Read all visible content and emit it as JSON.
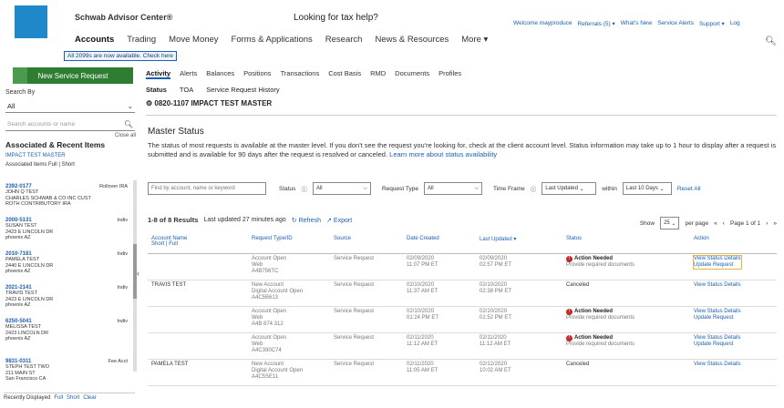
{
  "header": {
    "brand": "Schwab Advisor Center®",
    "tax_help": "Looking for tax help?",
    "util": [
      "Welcome mayproduce",
      "Referrals (5) ▾",
      "What's New",
      "Service Alerts",
      "Support ▾",
      "Log"
    ],
    "nav": [
      "Accounts",
      "Trading",
      "Move Money",
      "Forms & Applications",
      "Research",
      "News & Resources",
      "More ▾"
    ],
    "banner": "All 2099s are now available. Check here"
  },
  "new_request": "New Service Request",
  "subnav": [
    "Activity",
    "Alerts",
    "Balances",
    "Positions",
    "Transactions",
    "Cost Basis",
    "RMD",
    "Documents",
    "Profiles"
  ],
  "sidebar": {
    "search_by_label": "Search By",
    "search_by_value": "All",
    "search_placeholder": "Search accounts or name",
    "assoc_title": "Associated & Recent Items",
    "close_all": "Close all",
    "impact_acct": "IMPACT TEST MASTER",
    "assoc_items": "Associated items  Full | Short",
    "accounts": [
      {
        "num": "2392-0177",
        "type": "Rollover IRA",
        "lines": [
          "JOHN Q TEST",
          "CHARLES SCHWAB & CO INC CUST",
          "ROTH CONTRIBUTORY IRA"
        ]
      },
      {
        "num": "2000-5131",
        "type": "Indiv",
        "lines": [
          "SUSAN TEST",
          "2423 E LINCOLN DR",
          "phoenix AZ"
        ]
      },
      {
        "num": "2010-7181",
        "type": "Indiv",
        "lines": [
          "PAMELA TEST",
          "2440 E LINCOLN DR",
          "phoenix AZ"
        ]
      },
      {
        "num": "2021-2141",
        "type": "Indiv",
        "lines": [
          "TRAVIS TEST",
          "2423 E LINCOLN DR",
          "phoenix AZ"
        ]
      },
      {
        "num": "6250-5041",
        "type": "Indiv",
        "lines": [
          "MELISSA TEST",
          "2423 LINCOLN DR",
          "phoenix AZ"
        ]
      },
      {
        "num": "9831-0311",
        "type": "Fee Acct",
        "lines": [
          "STEPH TEST TWO",
          "211 MAIN ST",
          "San Francisco CA"
        ]
      }
    ],
    "bottom": [
      "Recently Displayed",
      "Full",
      "Short",
      "Clear"
    ]
  },
  "main": {
    "tabs": [
      "Status",
      "TOA",
      "Service Request History"
    ],
    "acct_header": "0820-1107  IMPACT TEST MASTER",
    "title": "Master Status",
    "description": "The status of most requests is available at the master level. If you don't see the request you're looking for, check at the client account level. Status information may take up to 1 hour to display after a request is submitted and is available for 90 days after the request is resolved or canceled.",
    "learn_more": "Learn more about status availability",
    "filters": {
      "keyword_placeholder": "Find by account, name or keyword",
      "status_label": "Status",
      "status_value": "All",
      "reqtype_label": "Request Type",
      "reqtype_value": "All",
      "timeframe_label": "Time Frame",
      "timeframe_value": "Last Updated",
      "within_label": "within",
      "within_value": "Last 10 Days",
      "reset": "Reset All"
    },
    "results_count": "1-8 of 8 Results",
    "results_updated": "Last updated 27 minutes ago",
    "refresh": "Refresh",
    "export": "Export",
    "pager": {
      "show": "Show",
      "show_value": "25",
      "per_page": "per page",
      "page": "Page 1 of 1"
    },
    "columns": [
      "Account Name\nShort | Full",
      "Request Type/ID",
      "Source",
      "Date Created",
      "Last Updated ▾",
      "Status",
      "Action"
    ],
    "rows": [
      {
        "acct": "",
        "type": "Account Open\nWeb\nA4B756TC",
        "source": "Service Request",
        "created": "02/09/2020\n11:07 PM ET",
        "updated": "02/09/2020\n02:57 PM ET",
        "status_type": "action",
        "status": "Action Needed",
        "status_sub": "Provide required documents",
        "action": "View Status Details\nUpdate Request",
        "highlight": true
      },
      {
        "acct": "TRAVIS TEST",
        "type": "New Account\nDigital Account Open\nA4C5B613",
        "source": "Service Request",
        "created": "02/10/2020\n11:37 AM ET",
        "updated": "02/10/2020\n02:38 PM ET",
        "status_type": "plain",
        "status": "Canceled",
        "status_sub": "",
        "action": "View Status Details",
        "highlight": false
      },
      {
        "acct": "",
        "type": "Account Open\nWeb\nA4B 874 312",
        "source": "Service Request",
        "created": "02/10/2020\n01:24 PM ET",
        "updated": "02/10/2020\n01:52 PM ET",
        "status_type": "action",
        "status": "Action Needed",
        "status_sub": "Provide required documents",
        "action": "View Status Details\nUpdate Request",
        "highlight": false
      },
      {
        "acct": "",
        "type": "Account Open\nWeb\nA4C390C74",
        "source": "Service Request",
        "created": "02/11/2020\n11:12 AM ET",
        "updated": "02/11/2020\n11:12 AM ET",
        "status_type": "action",
        "status": "Action Needed",
        "status_sub": "Provide required documents",
        "action": "View Status Details\nUpdate Request",
        "highlight": false
      },
      {
        "acct": "PAMELA TEST",
        "type": "New Account\nDigital Account Open\nA4C5SE11",
        "source": "Service Request",
        "created": "02/11/2020\n11:05 AM ET",
        "updated": "02/12/2020\n10:02 AM ET",
        "status_type": "plain",
        "status": "Canceled",
        "status_sub": "",
        "action": "View Status Details",
        "highlight": false
      }
    ]
  }
}
